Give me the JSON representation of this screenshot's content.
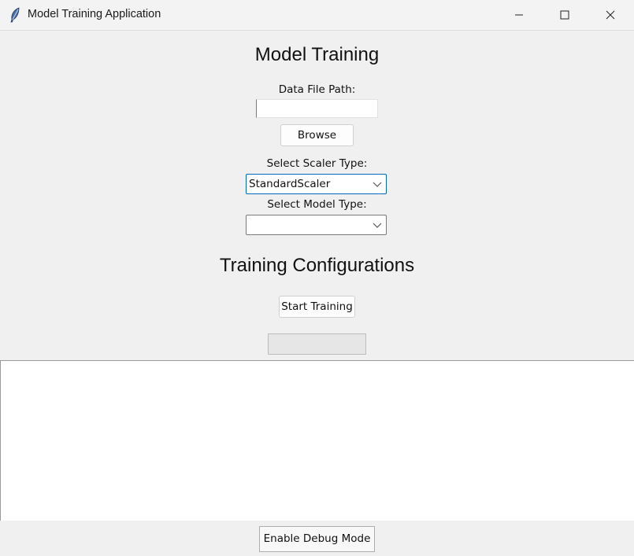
{
  "window": {
    "title": "Model Training Application",
    "icon": "feather-icon"
  },
  "main": {
    "title": "Model Training",
    "data_file_label": "Data File Path:",
    "data_file_value": "",
    "browse_label": "Browse",
    "scaler_label": "Select Scaler Type:",
    "scaler_value": "StandardScaler",
    "model_label": "Select Model Type:",
    "model_value": "",
    "config_title": "Training Configurations",
    "start_label": "Start Training",
    "progress": 0
  },
  "log": {
    "text": ""
  },
  "footer": {
    "debug_label": "Enable Debug Mode"
  },
  "colors": {
    "focus_accent": "#0067c0",
    "background": "#f0f0f0"
  }
}
